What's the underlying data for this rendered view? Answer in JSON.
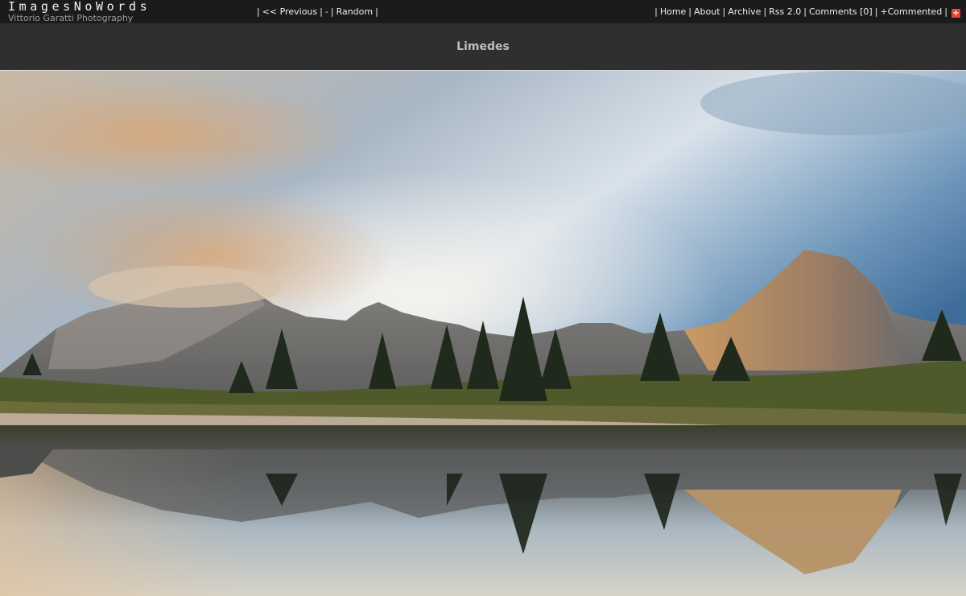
{
  "site": {
    "title": "ImagesNoWords",
    "subtitle": "Vittorio Garatti Photography"
  },
  "nav_center": {
    "previous": "<< Previous",
    "dash": "-",
    "random": "Random"
  },
  "nav_right": {
    "home": "Home",
    "about": "About",
    "archive": "Archive",
    "rss": "Rss 2.0",
    "comments": "Comments [0]",
    "commented": "+Commented",
    "plus_icon": "+"
  },
  "separator": "|",
  "photo": {
    "title": "Limedes"
  },
  "colors": {
    "topbar": "#1b1b1b",
    "band": "#2f2f2f",
    "accent": "#e8432f"
  }
}
